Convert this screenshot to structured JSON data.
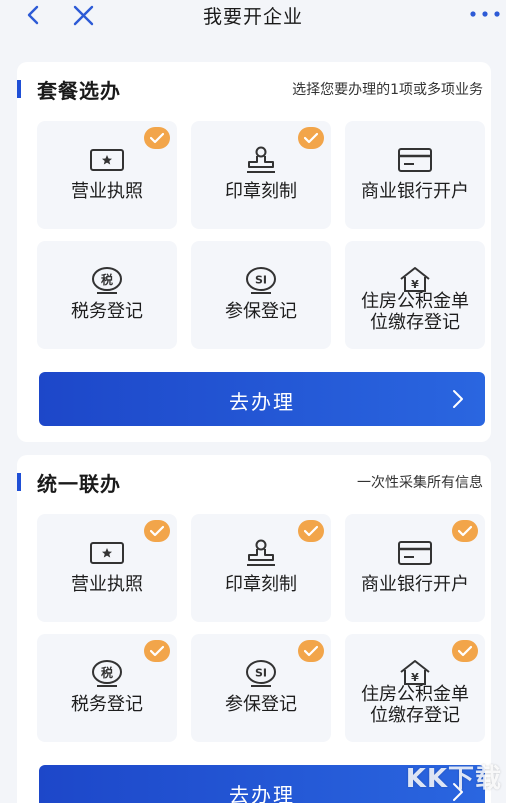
{
  "header": {
    "title": "我要开企业"
  },
  "section1": {
    "title": "套餐选办",
    "subtitle": "选择您要办理的1项或多项业务",
    "tiles": [
      {
        "label": "营业执照",
        "checked": true
      },
      {
        "label": "印章刻制",
        "checked": true
      },
      {
        "label": "商业银行开户",
        "checked": false
      },
      {
        "label": "税务登记",
        "checked": false,
        "icon_text": "税"
      },
      {
        "label": "参保登记",
        "checked": false,
        "icon_text": "SI"
      },
      {
        "label1": "住房公积金单",
        "label2": "位缴存登记",
        "checked": false,
        "icon_text": "¥"
      }
    ],
    "button": "去办理"
  },
  "section2": {
    "title": "统一联办",
    "subtitle": "一次性采集所有信息",
    "tiles": [
      {
        "label": "营业执照",
        "checked": true
      },
      {
        "label": "印章刻制",
        "checked": true
      },
      {
        "label": "商业银行开户",
        "checked": true
      },
      {
        "label": "税务登记",
        "checked": true,
        "icon_text": "税"
      },
      {
        "label": "参保登记",
        "checked": true,
        "icon_text": "SI"
      },
      {
        "label1": "住房公积金单",
        "label2": "位缴存登记",
        "checked": true,
        "icon_text": "¥"
      }
    ],
    "button": "去办理"
  },
  "watermark": "KK下载",
  "colors": {
    "accent": "#1f4fd6",
    "check": "#f2a54a",
    "tile_bg": "#f4f6fa"
  }
}
